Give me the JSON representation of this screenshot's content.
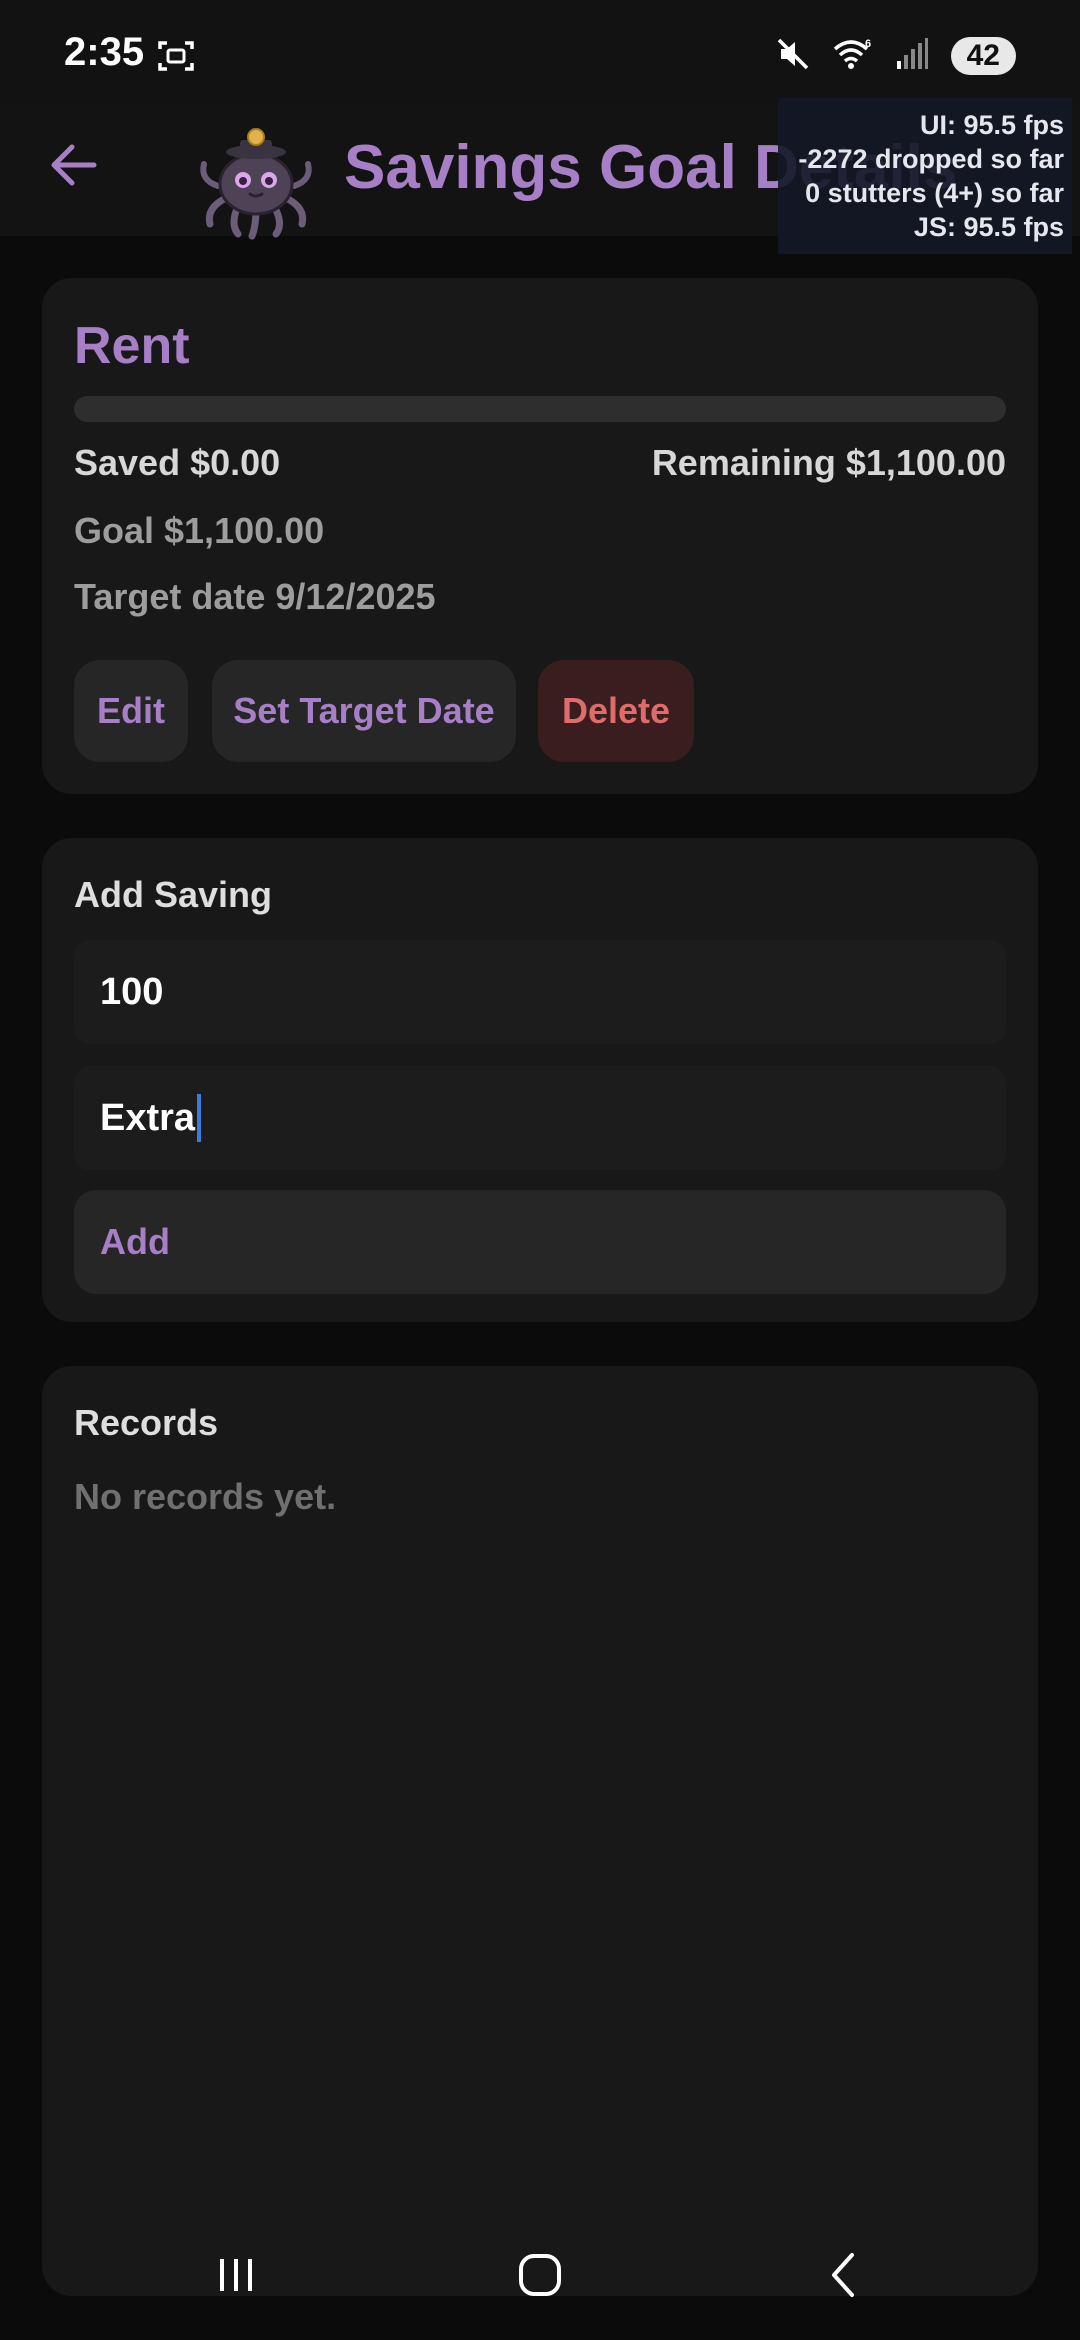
{
  "status_bar": {
    "time": "2:35",
    "battery": "42",
    "icons": [
      "screenshot-icon",
      "mute-icon",
      "wifi-icon",
      "signal-icon"
    ]
  },
  "header": {
    "title": "Savings Goal Details",
    "icons": [
      "back-arrow-icon",
      "octopus-mascot-logo"
    ]
  },
  "perf_overlay": {
    "ui": "UI: 95.5 fps",
    "dropped": "-2272 dropped so far",
    "stutters": "0 stutters (4+) so far",
    "js": "JS: 95.5 fps"
  },
  "goal": {
    "name": "Rent",
    "progress_fraction": 0.0,
    "saved": "Saved $0.00",
    "remaining": "Remaining $1,100.00",
    "goal_amount": "Goal $1,100.00",
    "target_date": "Target date 9/12/2025",
    "buttons": {
      "edit": "Edit",
      "set_target_date": "Set Target Date",
      "delete": "Delete"
    }
  },
  "add_saving": {
    "title": "Add Saving",
    "amount_value": "100",
    "note_value": "Extra",
    "add_label": "Add"
  },
  "records": {
    "title": "Records",
    "empty_message": "No records yet."
  },
  "colors": {
    "accent": "#a77fc7",
    "danger": "#e06b6b",
    "danger_bg": "#3a1d1e",
    "card": "#181818",
    "background": "#0b0b0b",
    "caret": "#3b7bd9"
  },
  "nav_bar": {
    "icons": [
      "recents-icon",
      "home-icon",
      "back-icon"
    ]
  }
}
